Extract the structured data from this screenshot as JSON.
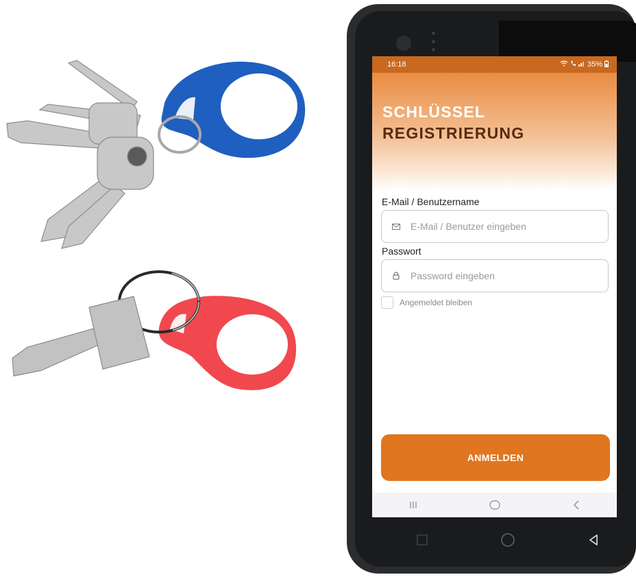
{
  "status": {
    "time": "16:18",
    "battery": "35%"
  },
  "app": {
    "title_line1": "SCHLÜSSEL",
    "title_line2": "REGISTRIERUNG"
  },
  "form": {
    "email_label": "E-Mail / Benutzername",
    "email_placeholder": "E-Mail / Benutzer eingeben",
    "email_value": "",
    "password_label": "Passwort",
    "password_placeholder": "Password eingeben",
    "password_value": "",
    "remember_label": "Angemeldet bleiben",
    "remember_checked": false,
    "submit_label": "ANMELDEN"
  },
  "nav": {
    "recents_icon": "recents-icon",
    "home_icon": "home-icon",
    "back_icon": "back-icon"
  },
  "icons": {
    "mail": "mail-icon",
    "lock": "lock-icon",
    "wifi": "wifi-icon",
    "signal": "signal-icon",
    "battery": "battery-icon"
  },
  "colors": {
    "accent": "#e07620",
    "title_dark": "#5a2a10",
    "tag_blue": "#1f5fbf",
    "tag_red": "#f0484e"
  }
}
